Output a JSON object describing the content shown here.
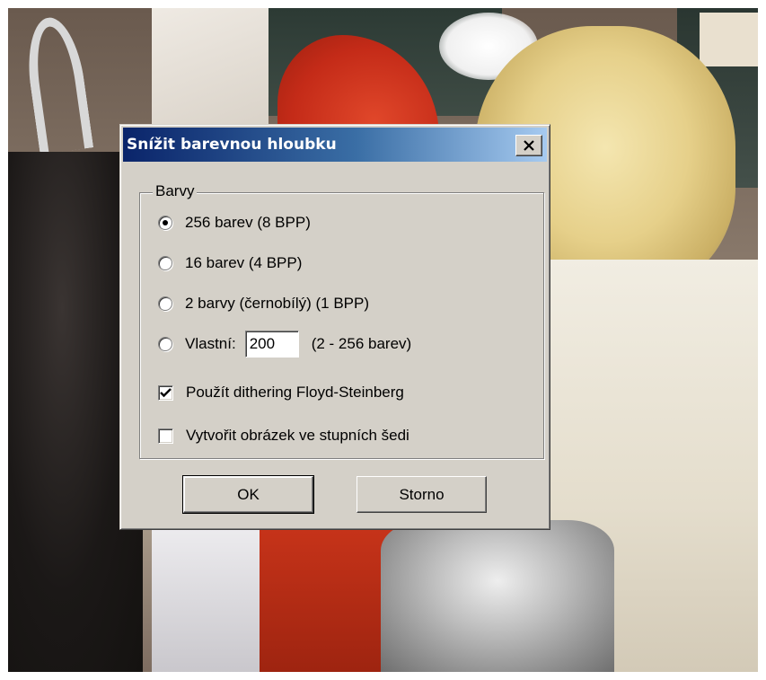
{
  "dialog": {
    "title": "Snížit barevnou hloubku",
    "close_glyph": "X",
    "group_label": "Barvy",
    "options": {
      "opt_256": {
        "label": "256 barev (8 BPP)",
        "checked": true
      },
      "opt_16": {
        "label": "16 barev (4 BPP)",
        "checked": false
      },
      "opt_2": {
        "label": "2 barvy (černobílý) (1 BPP)",
        "checked": false
      },
      "opt_custom": {
        "label": "Vlastní:",
        "value": "200",
        "range_label": "(2 - 256 barev)",
        "checked": false
      }
    },
    "checkboxes": {
      "dithering": {
        "label": "Použít dithering Floyd-Steinberg",
        "checked": true
      },
      "grayscale": {
        "label": "Vytvořit obrázek ve stupních šedi",
        "checked": false
      }
    },
    "buttons": {
      "ok": "OK",
      "cancel": "Storno"
    }
  },
  "colors": {
    "titlebar_start": "#0a246a",
    "titlebar_end": "#a6caf0",
    "dialog_face": "#d4d0c8"
  }
}
